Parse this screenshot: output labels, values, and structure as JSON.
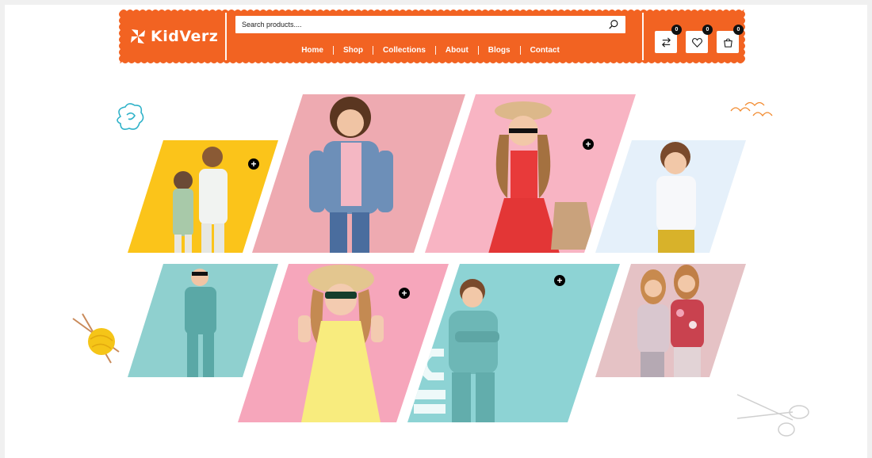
{
  "brand": {
    "name": "KidVerz",
    "color": "#f26322"
  },
  "search": {
    "placeholder": "Search products....",
    "icon": "search-icon"
  },
  "nav": {
    "items": [
      {
        "label": "Home"
      },
      {
        "label": "Shop"
      },
      {
        "label": "Collections"
      },
      {
        "label": "About"
      },
      {
        "label": "Blogs"
      },
      {
        "label": "Contact"
      }
    ]
  },
  "header_icons": [
    {
      "name": "compare-icon",
      "count": "0"
    },
    {
      "name": "heart-icon",
      "count": "0"
    },
    {
      "name": "cart-icon",
      "count": "0"
    }
  ],
  "gallery": {
    "tiles": [
      {
        "name": "tile-yellow-kids",
        "color": "#fbc41a"
      },
      {
        "name": "tile-denim-girl",
        "color": "#eeaab1"
      },
      {
        "name": "tile-red-dress-girl",
        "color": "#f8b4c3"
      },
      {
        "name": "tile-white-shirt-boy",
        "color": "#e5f0fa"
      },
      {
        "name": "tile-teal-hoodie-boy",
        "color": "#8fd0cf"
      },
      {
        "name": "tile-yellow-dress-girl",
        "color": "#f6a6bb"
      },
      {
        "name": "tile-teal-sweatshirt-boy",
        "color": "#8dd3d4"
      },
      {
        "name": "tile-floral-sisters",
        "color": "#e5c2c5"
      }
    ],
    "plus_label": "+"
  }
}
